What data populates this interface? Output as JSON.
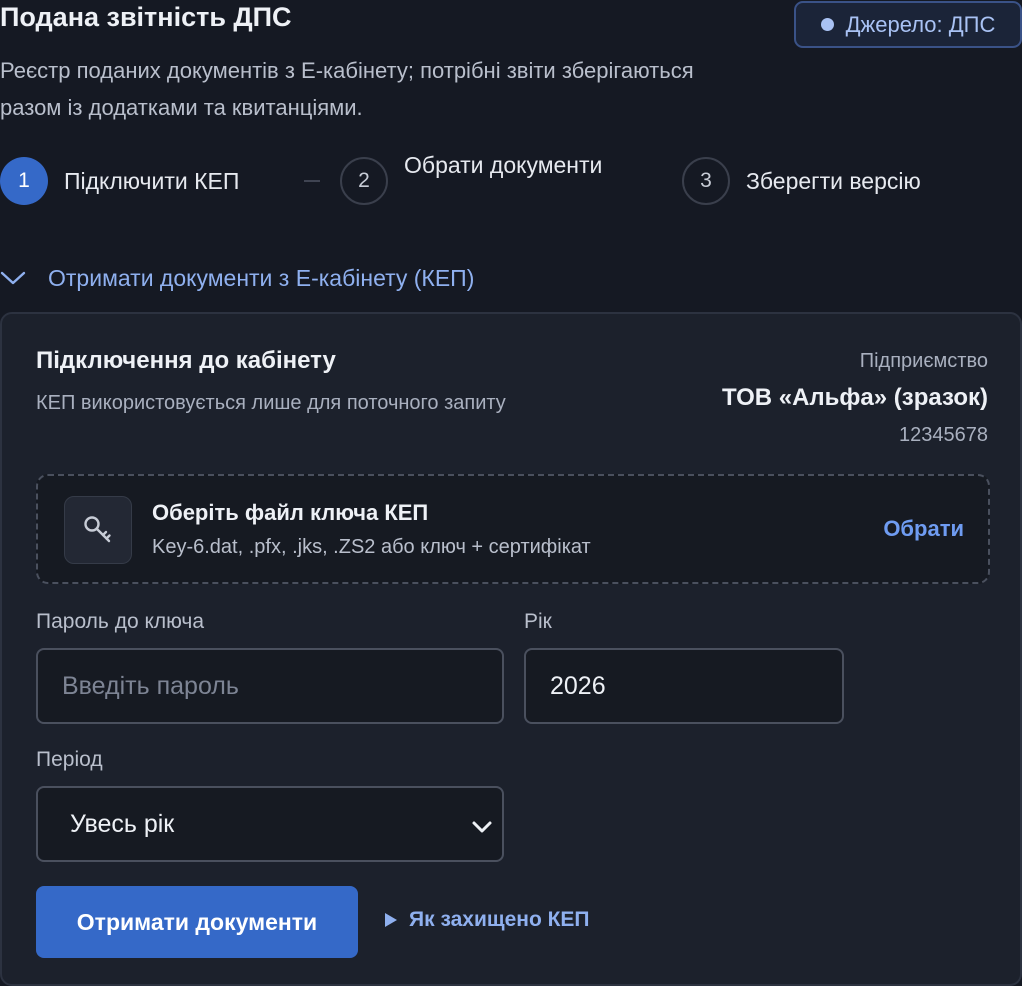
{
  "header": {
    "title": "Подана звітність ДПС",
    "source_badge": "Джерело: ДПС",
    "subtitle": "Реєстр поданих документів з Е-кабінету; потрібні звіти зберігаються разом із додатками та квитанціями."
  },
  "stepper": {
    "steps": [
      {
        "number": "1",
        "label": "Підключити КЕП",
        "active": true
      },
      {
        "number": "2",
        "label": "Обрати документи",
        "active": false
      },
      {
        "number": "3",
        "label": "Зберегти версію",
        "active": false
      }
    ]
  },
  "accordion": {
    "title": "Отримати документи з Е-кабінету (КЕП)",
    "expanded": true,
    "icon": "chevron-down-icon"
  },
  "connection": {
    "title": "Підключення до кабінету",
    "subtitle": "КЕП використовується лише для поточного запиту",
    "org_label": "Підприємство",
    "org_name": "ТОВ «Альфа» (зразок)",
    "org_code": "12345678"
  },
  "key_file": {
    "icon": "key-icon",
    "title": "Оберіть файл ключа КЕП",
    "hint": "Key-6.dat, .pfx, .jks, .ZS2 або ключ + сертифікат",
    "choose_label": "Обрати"
  },
  "form": {
    "password_label": "Пароль до ключа",
    "password_placeholder": "Введіть пароль",
    "password_value": "",
    "year_label": "Рік",
    "year_value": "2026",
    "period_label": "Період",
    "period_value": "Увесь рік"
  },
  "actions": {
    "submit_label": "Отримати документи",
    "help_label": "Як захищено КЕП"
  },
  "colors": {
    "accent": "#3569c8",
    "link": "#8fb0ef",
    "background": "#151923",
    "card": "#1c212c"
  }
}
